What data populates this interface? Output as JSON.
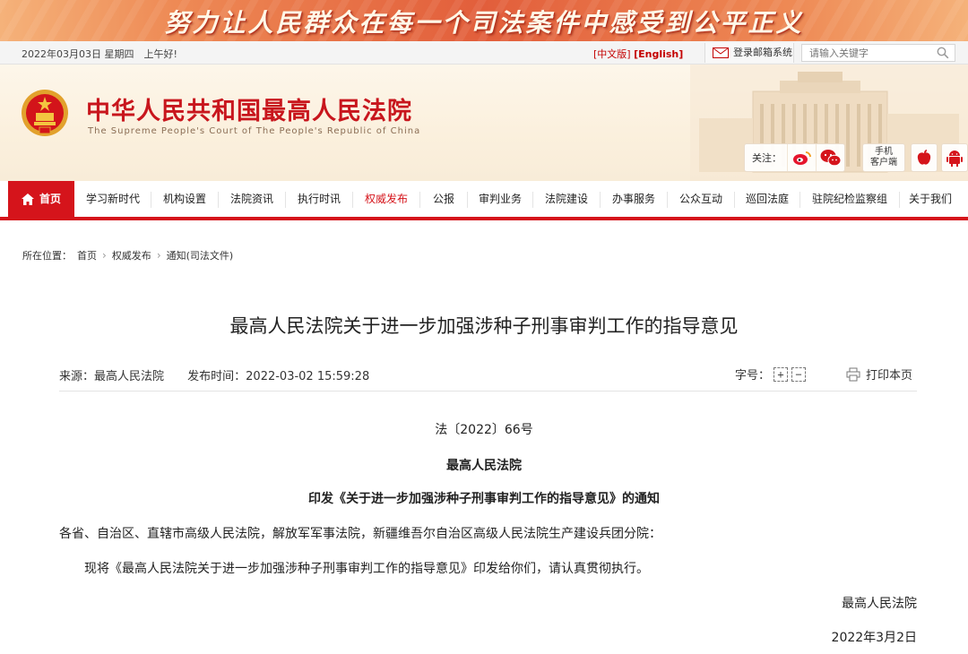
{
  "banner": {
    "slogan": "努力让人民群众在每一个司法案件中感受到公平正义"
  },
  "utility": {
    "date": "2022年03月03日 星期四　上午好!",
    "lang_left": "[中文版]",
    "lang_right": "[English]",
    "mail": "登录邮箱系统",
    "search_placeholder": "请输入关键字"
  },
  "header": {
    "name_cn": "中华人民共和国最高人民法院",
    "name_en": "The Supreme People's Court of The People's Republic of China",
    "follow_label": "关注：",
    "client_line1": "手机",
    "client_line2": "客户端"
  },
  "nav": [
    "首页",
    "学习新时代",
    "机构设置",
    "法院资讯",
    "执行时讯",
    "权威发布",
    "公报",
    "审判业务",
    "法院建设",
    "办事服务",
    "公众互动",
    "巡回法庭",
    "驻院纪检监察组",
    "关于我们"
  ],
  "breadcrumb": {
    "label": "所在位置：",
    "items": [
      "首页",
      "权威发布",
      "通知(司法文件)"
    ]
  },
  "article": {
    "title": "最高人民法院关于进一步加强涉种子刑事审判工作的指导意见",
    "source": "来源：最高人民法院",
    "time": "发布时间：2022-03-02 15:59:28",
    "font_label": "字号：",
    "font_plus": "+",
    "font_minus": "−",
    "print_label": "打印本页",
    "doc_number": "法〔2022〕66号",
    "issuer": "最高人民法院",
    "notice_title": "印发《关于进一步加强涉种子刑事审判工作的指导意见》的通知",
    "addressees": "各省、自治区、直辖市高级人民法院，解放军军事法院，新疆维吾尔自治区高级人民法院生产建设兵团分院：",
    "body": "现将《最高人民法院关于进一步加强涉种子刑事审判工作的指导意见》印发给你们，请认真贯彻执行。",
    "signature": "最高人民法院",
    "date": "2022年3月2日"
  },
  "colors": {
    "brand_red": "#d5141b",
    "banner_orange": "#e25e3b",
    "header_cream": "#fbf0dd"
  },
  "icons": [
    "emblem-icon",
    "mail-icon",
    "search-icon",
    "weibo-icon",
    "wechat-icon",
    "apple-icon",
    "android-icon",
    "home-icon",
    "print-icon"
  ]
}
